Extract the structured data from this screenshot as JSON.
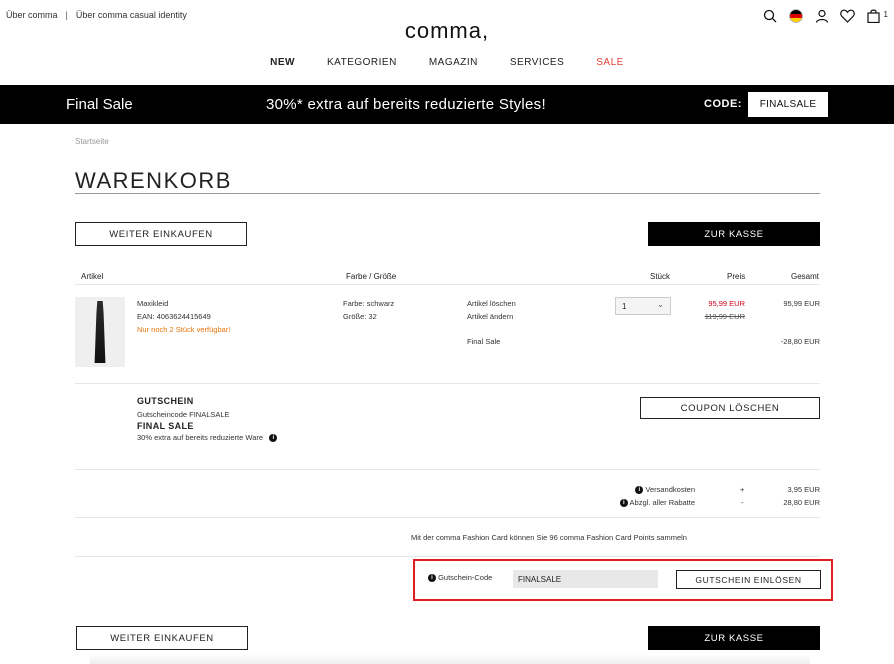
{
  "topbar": {
    "link1": "Über comma",
    "link2": "Über comma casual identity",
    "logo": "comma,",
    "cart_count": "1"
  },
  "nav": [
    "NEW",
    "KATEGORIEN",
    "MAGAZIN",
    "SERVICES",
    "SALE"
  ],
  "banner": {
    "left": "Final Sale",
    "promo": "30%* extra auf bereits reduzierte Styles!",
    "code_label": "CODE:",
    "code": "FINALSALE"
  },
  "breadcrumb": "Startseite",
  "page_title": "WARENKORB",
  "buttons": {
    "continue": "WEITER EINKAUFEN",
    "checkout": "ZUR KASSE",
    "coupon_delete": "COUPON LÖSCHEN",
    "redeem": "GUTSCHEIN EINLÖSEN"
  },
  "table_headers": {
    "article": "Artikel",
    "color_size": "Farbe / Größe",
    "qty": "Stück",
    "price": "Preis",
    "total": "Gesamt"
  },
  "item": {
    "name": "Maxikleid",
    "ean": "EAN: 4063624415649",
    "stock": "Nur noch 2 Stück verfügbar!",
    "color": "Farbe: schwarz",
    "size": "Größe: 32",
    "delete": "Artikel löschen",
    "change": "Artikel ändern",
    "qty": "1",
    "price_new": "95,99 EUR",
    "price_old": "119,99 EUR",
    "total": "95,99 EUR",
    "discount_label": "Final Sale",
    "discount_value": "-28,80 EUR"
  },
  "voucher": {
    "title": "GUTSCHEIN",
    "code_line": "Gutscheincode FINALSALE",
    "name": "FINAL SALE",
    "desc": "30% extra auf bereits reduzierte Ware"
  },
  "summary": {
    "shipping_label": "Versandkosten",
    "shipping_sign": "+",
    "shipping_value": "3,95 EUR",
    "rebate_label": "Abzgl. aller Rabatte",
    "rebate_sign": "-",
    "rebate_value": "28,80 EUR"
  },
  "fashion_card": "Mit der comma Fashion Card können Sie 96 comma Fashion Card Points sammeln",
  "voucher_form": {
    "label": "Gutschein-Code",
    "value": "FINALSALE"
  },
  "colors": {
    "sale": "#e0403a",
    "price_red": "#d0021b",
    "stock_orange": "#e8750d",
    "highlight": "#e01e1e"
  }
}
